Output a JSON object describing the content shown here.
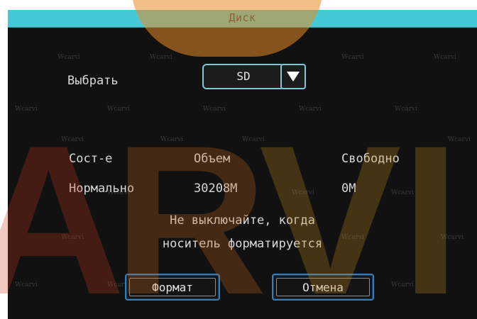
{
  "dialog": {
    "title": "Диск",
    "select_label": "Выбрать",
    "storage_select": {
      "value": "SD"
    },
    "status_table": {
      "headers": [
        "Сост-е",
        "Объем",
        "Свободно"
      ],
      "row": [
        "Нормально",
        "30208M",
        "0M"
      ]
    },
    "warning": {
      "line1": "Не выключайте, когда",
      "line2": "носитель форматируется"
    },
    "format_button": "Формат",
    "cancel_button": "Отмена"
  },
  "watermark": {
    "tag": "Wcarvi",
    "letters": [
      "A",
      "R",
      "V",
      "I"
    ]
  },
  "colors": {
    "title_bar": "#46c9d6",
    "dialog_bg": "#111111",
    "dropdown_border": "#7ec7d4",
    "button_border": "#2f7fbf",
    "watermark_orange": "#e98a26",
    "watermark_red": "#c83a1c"
  }
}
